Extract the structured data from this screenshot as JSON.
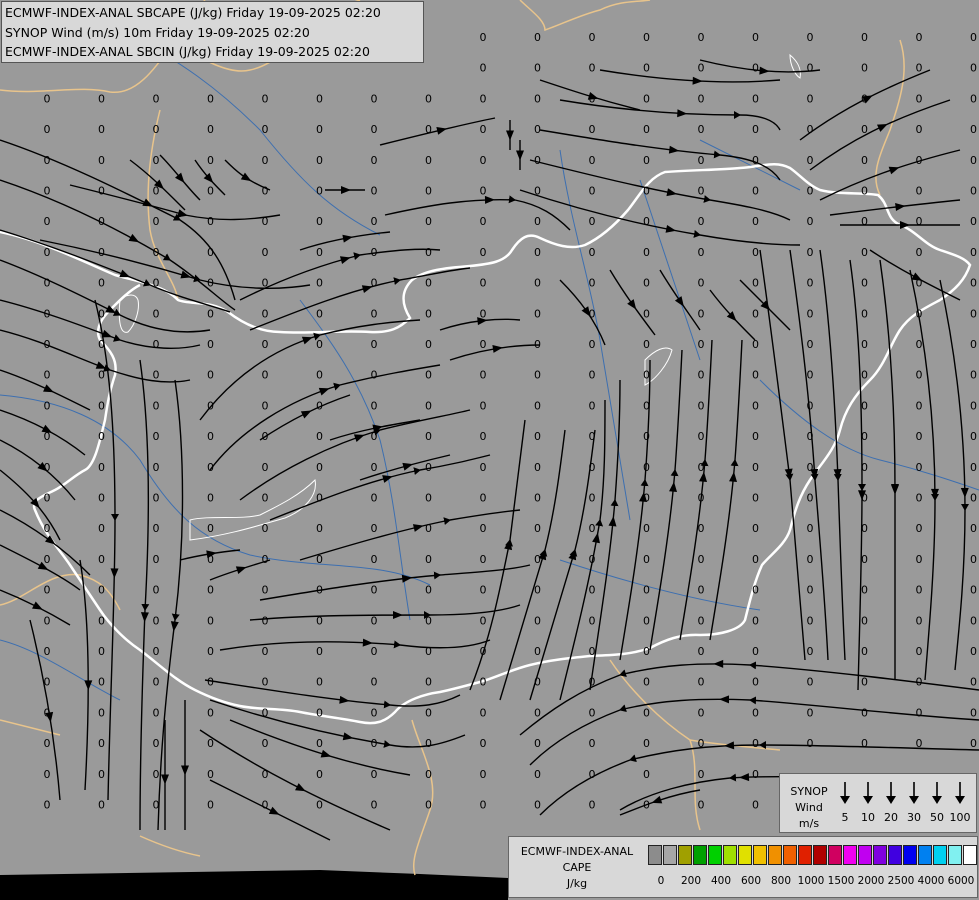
{
  "title": {
    "line1": "ECMWF-INDEX-ANAL SBCAPE (J/kg) Friday 19-09-2025 02:20",
    "line2": "SYNOP Wind (m/s) 10m Friday 19-09-2025 02:20",
    "line3": "ECMWF-INDEX-ANAL SBCIN (J/kg) Friday 19-09-2025 02:20"
  },
  "synop_legend": {
    "label": "SYNOP\nWind\nm/s",
    "speeds": [
      "5",
      "10",
      "20",
      "30",
      "50",
      "100"
    ]
  },
  "cape_legend": {
    "title": "ECMWF-INDEX-ANAL\nCAPE\nJ/kg",
    "colors": [
      "#8c8c8c",
      "#a6a6a6",
      "#a0a000",
      "#00a000",
      "#00d000",
      "#a0e000",
      "#e0e000",
      "#f0c000",
      "#f09000",
      "#f06000",
      "#e02000",
      "#b00000",
      "#d00060",
      "#f000f0",
      "#c000f0",
      "#8000e0",
      "#4000e0",
      "#0000f0",
      "#0080f0",
      "#00d0f0",
      "#80f0f0",
      "#ffffff"
    ],
    "ticks": [
      "0",
      "200",
      "400",
      "600",
      "800",
      "1000",
      "1500",
      "2000",
      "2500",
      "4000",
      "6000"
    ]
  },
  "map": {
    "field_value": "0",
    "colors": {
      "background": "#9a9a9a",
      "border": "#ffffff",
      "neighbor_border": "#e8c48c",
      "river": "#3d6fb0",
      "streamline": "#000000"
    }
  }
}
